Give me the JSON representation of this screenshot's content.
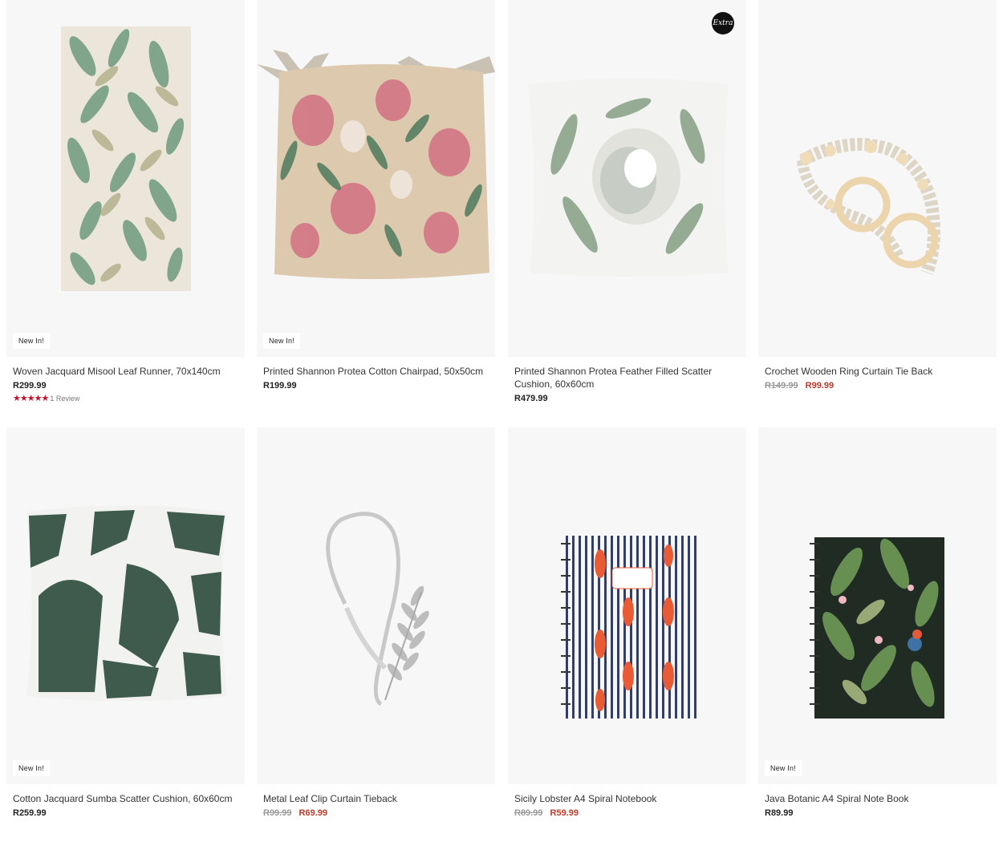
{
  "products": [
    {
      "title": "Woven Jacquard Misool Leaf Runner, 70x140cm",
      "price": "R299.99",
      "badge": "New In!",
      "rating_stars": "★★★★★",
      "reviews": "1 Review",
      "image": "leaf-runner-image"
    },
    {
      "title": "Printed Shannon Protea Cotton Chairpad, 50x50cm",
      "price": "R199.99",
      "badge": "New In!",
      "image": "protea-chairpad-image"
    },
    {
      "title": "Printed Shannon Protea Feather Filled Scatter Cushion, 60x60cm",
      "price": "R479.99",
      "extra_badge": "Extra",
      "image": "protea-cushion-image"
    },
    {
      "title": "Crochet Wooden Ring Curtain Tie Back",
      "was_price": "R149.99",
      "sale_price": "R99.99",
      "image": "curtain-tieback-image"
    },
    {
      "title": "Cotton Jacquard Sumba Scatter Cushion, 60x60cm",
      "price": "R259.99",
      "badge": "New In!",
      "image": "sumba-cushion-image"
    },
    {
      "title": "Metal Leaf Clip Curtain Tieback",
      "was_price": "R99.99",
      "sale_price": "R69.99",
      "image": "metal-leaf-tieback-image"
    },
    {
      "title": "Sicily Lobster A4 Spiral Notebook",
      "was_price": "R89.99",
      "sale_price": "R59.99",
      "image": "lobster-notebook-image"
    },
    {
      "title": "Java Botanic A4 Spiral Note Book",
      "price": "R89.99",
      "badge": "New In!",
      "image": "botanic-notebook-image"
    }
  ],
  "colors": {
    "sale": "#c0392b",
    "star": "#c8102e",
    "tile_bg": "#f7f7f7"
  }
}
